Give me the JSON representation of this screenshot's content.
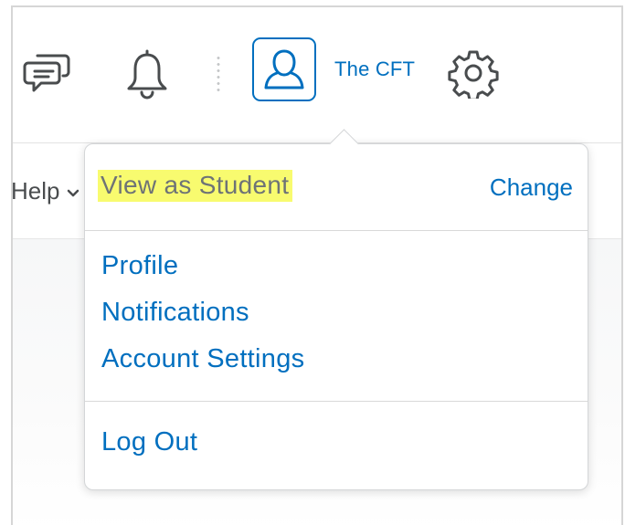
{
  "header": {
    "user_name": "The CFT",
    "icons": {
      "messages": "chat-bubbles-icon",
      "notifications": "bell-icon",
      "avatar": "user-avatar-icon",
      "settings": "gear-icon"
    }
  },
  "navbar": {
    "help_label": "Help"
  },
  "dropdown": {
    "role_label": "View as Student",
    "change_label": "Change",
    "items": [
      {
        "label": "Profile"
      },
      {
        "label": "Notifications"
      },
      {
        "label": "Account Settings"
      }
    ],
    "logout_label": "Log Out"
  },
  "colors": {
    "accent": "#006fbf",
    "highlight": "#f8fb6f",
    "icon_gray": "#494c4e"
  }
}
